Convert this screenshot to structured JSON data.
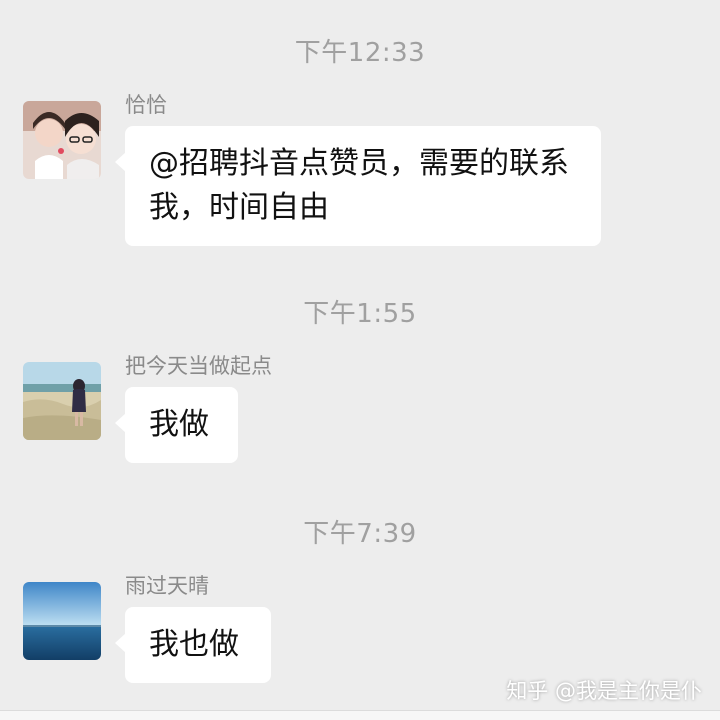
{
  "messages": [
    {
      "timestamp": "下午12:33",
      "sender": "恰恰",
      "text": "@招聘抖音点赞员，需要的联系我，时间自由",
      "avatar_icon": "two-girls-photo-avatar"
    },
    {
      "timestamp": "下午1:55",
      "sender": "把今天当做起点",
      "text": "我做",
      "avatar_icon": "girl-in-field-photo-avatar"
    },
    {
      "timestamp": "下午7:39",
      "sender": "雨过天晴",
      "text": "我也做",
      "avatar_icon": "sea-sky-photo-avatar"
    }
  ],
  "watermark": "知乎 @我是主你是仆",
  "colors": {
    "background": "#ededed",
    "bubble": "#ffffff",
    "timestamp": "#a0a0a0",
    "sender": "#8a8a8a"
  }
}
